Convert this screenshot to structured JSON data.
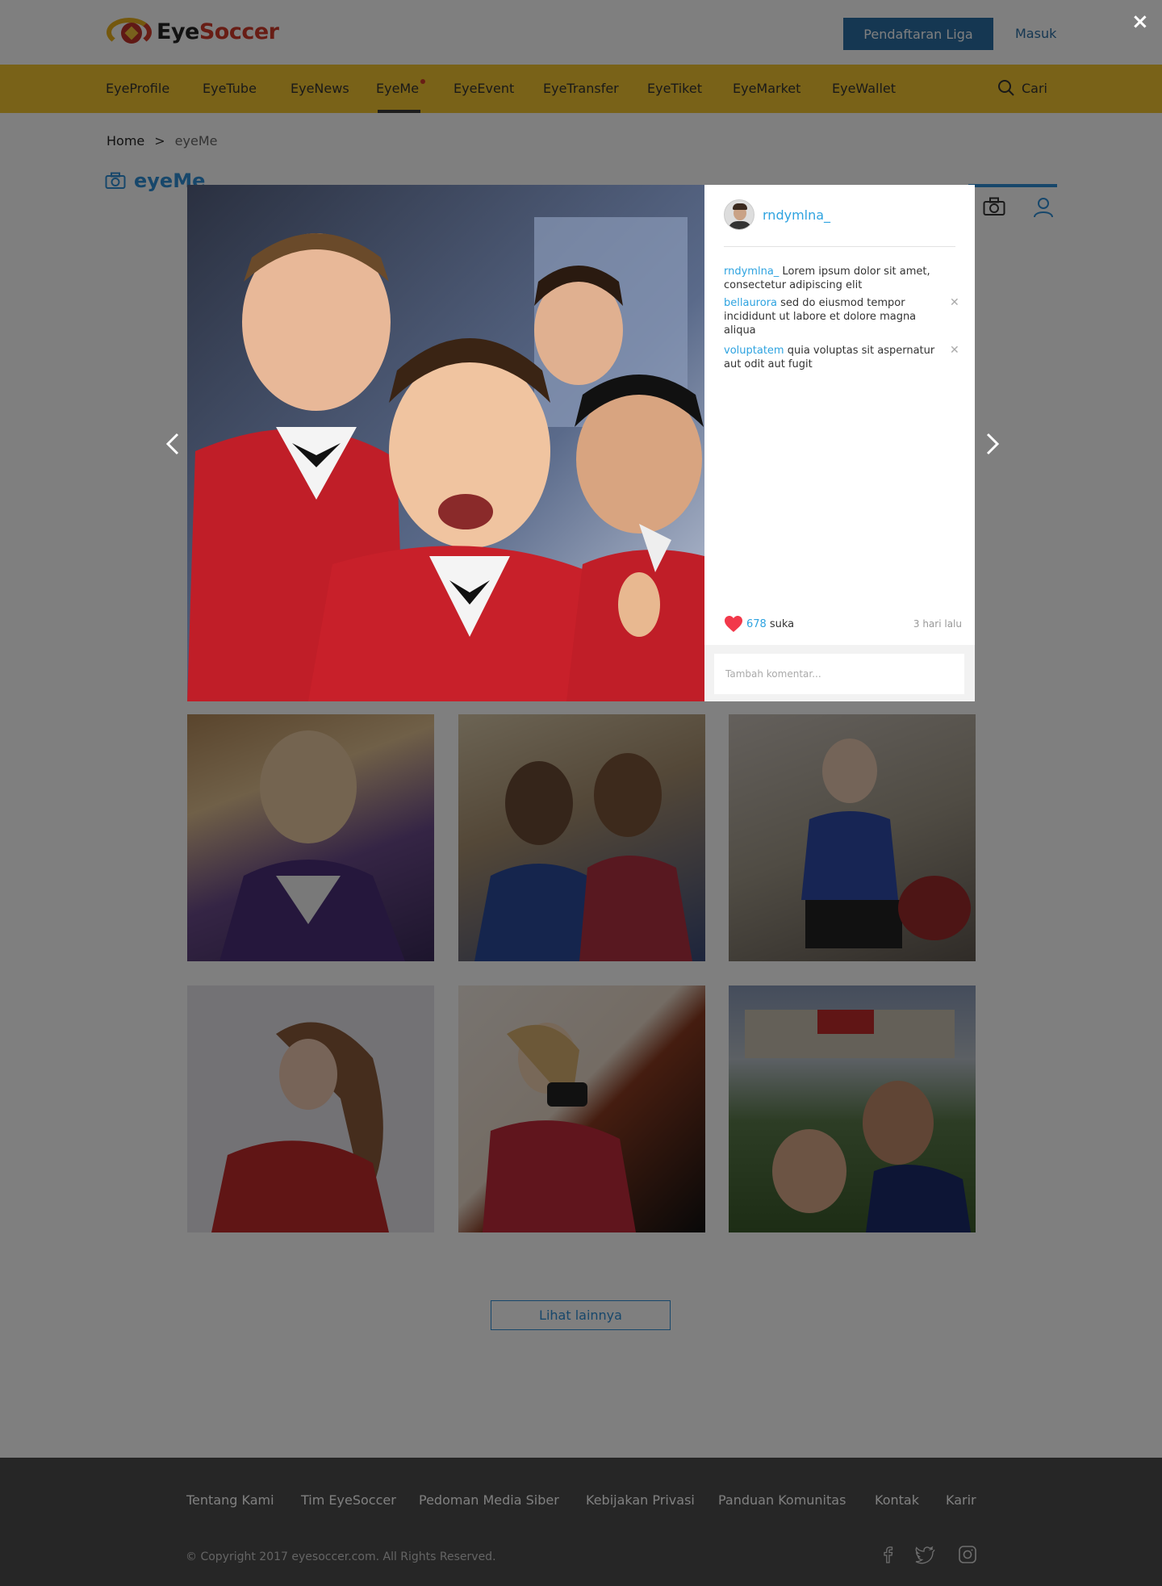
{
  "header": {
    "logo_eye": "Eye",
    "logo_soccer": "Soccer",
    "register_button": "Pendaftaran Liga",
    "login_link": "Masuk"
  },
  "nav": {
    "items": [
      {
        "label": "EyeProfile"
      },
      {
        "label": "EyeTube"
      },
      {
        "label": "EyeNews"
      },
      {
        "label": "EyeMe",
        "active": true,
        "dot": true
      },
      {
        "label": "EyeEvent"
      },
      {
        "label": "EyeTransfer"
      },
      {
        "label": "EyeTiket"
      },
      {
        "label": "EyeMarket"
      },
      {
        "label": "EyeWallet"
      }
    ],
    "search_label": "Cari"
  },
  "breadcrumb": {
    "home": "Home",
    "separator": ">",
    "current": "eyeMe"
  },
  "section": {
    "title": "eyeMe"
  },
  "gallery": {
    "photos": [
      {
        "subject": "woman in purple jersey selfie"
      },
      {
        "subject": "two men in cricket jerseys"
      },
      {
        "subject": "girl mirror selfie in blue jersey"
      },
      {
        "subject": "woman in red jersey"
      },
      {
        "subject": "woman mirror selfie in red jersey"
      },
      {
        "subject": "two men at baseball stadium"
      }
    ],
    "more_button": "Lihat lainnya"
  },
  "footer": {
    "links": [
      "Tentang Kami",
      "Tim EyeSoccer",
      "Pedoman Media Siber",
      "Kebijakan Privasi",
      "Panduan Komunitas",
      "Kontak",
      "Karir"
    ],
    "copyright": "© Copyright 2017 eyesoccer.com. All Rights Reserved.",
    "social_icons": [
      "facebook-icon",
      "twitter-icon",
      "instagram-icon"
    ]
  },
  "modal": {
    "username": "rndymlna_",
    "comments": [
      {
        "user": "rndymlna_",
        "text": " Lorem ipsum dolor sit amet, consectetur adipiscing elit",
        "removable": false
      },
      {
        "user": "bellaurora",
        "text": " sed do eiusmod tempor incididunt ut labore et dolore magna aliqua",
        "removable": true
      },
      {
        "user": "voluptatem",
        "text": " quia voluptas sit aspernatur aut odit aut fugit",
        "removable": true
      }
    ],
    "likes_count": "678",
    "likes_label": "suka",
    "time_ago": "3 hari lalu",
    "comment_placeholder": "Tambah komentar...",
    "close_label": "×"
  },
  "colors": {
    "brand_yellow": "#f3c431",
    "brand_blue": "#2a6ea5",
    "accent_blue": "#2ea3e0",
    "like_red": "#f2384a",
    "footer_bg": "#4d4d4d"
  }
}
